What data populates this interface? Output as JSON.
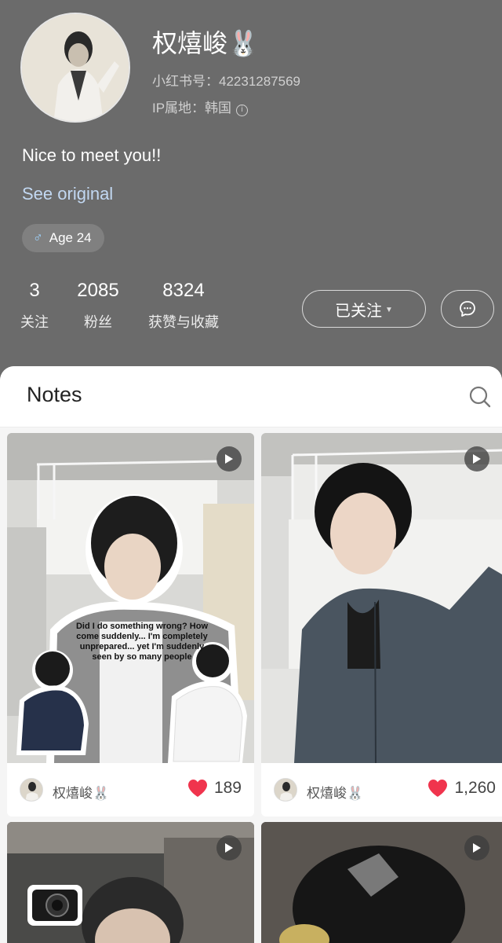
{
  "profile": {
    "name": "权熺峻",
    "name_emoji": "🐰",
    "id_label": "小红书号：42231287569",
    "ip_label": "IP属地：韩国",
    "bio": "Nice to meet you!!",
    "see_original": "See original",
    "tag": "Age 24",
    "stats": [
      {
        "num": "3",
        "label": "关注"
      },
      {
        "num": "2085",
        "label": "粉丝"
      },
      {
        "num": "8324",
        "label": "获赞与收藏"
      }
    ],
    "follow_label": "已关注"
  },
  "notes": {
    "title": "Notes",
    "cards": [
      {
        "author": "权熺峻🐰",
        "likes": "189",
        "caption": "Did I do something wrong? How come suddenly... I'm completely unprepared... yet I'm suddenly seen by so many people"
      },
      {
        "author": "权熺峻🐰",
        "likes": "1,260"
      }
    ]
  },
  "colors": {
    "header_bg": "#6b6b6b",
    "heart": "#f0344d",
    "link": "#c2d8f2"
  },
  "icons": [
    "info-icon",
    "male-icon",
    "chevron-down-icon",
    "chat-icon",
    "search-icon",
    "play-icon",
    "heart-icon"
  ]
}
